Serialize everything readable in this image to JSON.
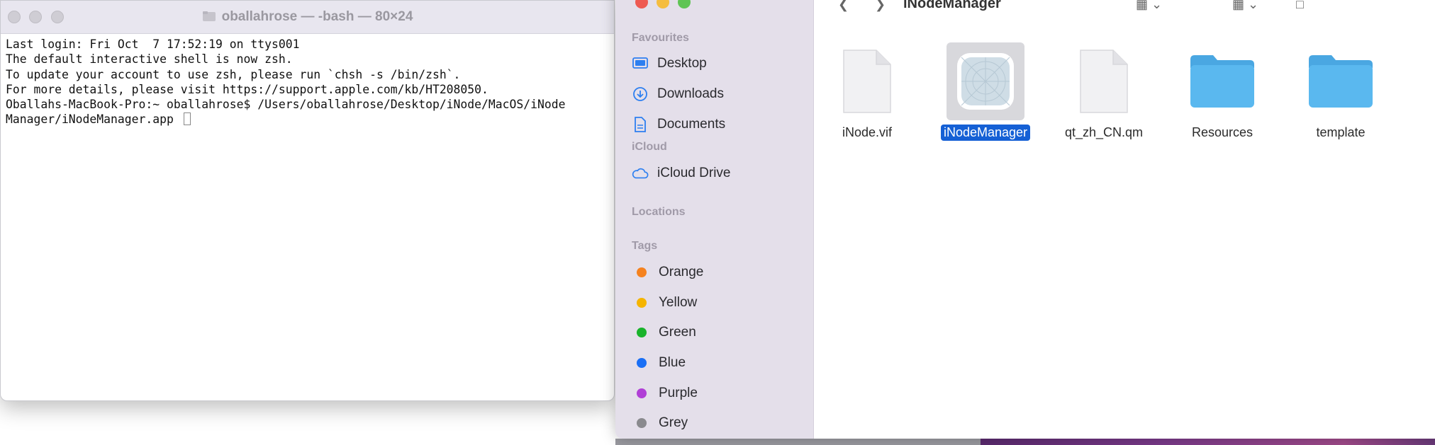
{
  "terminal": {
    "title": "oballahrose — -bash — 80×24",
    "lines": [
      "Last login: Fri Oct  7 17:52:19 on ttys001",
      "",
      "The default interactive shell is now zsh.",
      "To update your account to use zsh, please run `chsh -s /bin/zsh`.",
      "For more details, please visit https://support.apple.com/kb/HT208050.",
      "Oballahs-MacBook-Pro:~ oballahrose$ /Users/oballahrose/Desktop/iNode/MacOS/iNode",
      "Manager/iNodeManager.app "
    ]
  },
  "finder": {
    "title": "iNodeManager",
    "sidebar": {
      "favourites_heading": "Favourites",
      "favourites": [
        {
          "label": "Desktop",
          "icon": "desktop-icon"
        },
        {
          "label": "Downloads",
          "icon": "downloads-icon"
        },
        {
          "label": "Documents",
          "icon": "documents-icon"
        }
      ],
      "icloud_heading": "iCloud",
      "icloud": [
        {
          "label": "iCloud Drive",
          "icon": "icloud-icon"
        }
      ],
      "locations_heading": "Locations",
      "tags_heading": "Tags",
      "tags": [
        {
          "label": "Orange",
          "color": "#f5821f"
        },
        {
          "label": "Yellow",
          "color": "#f5b400"
        },
        {
          "label": "Green",
          "color": "#19b32b"
        },
        {
          "label": "Blue",
          "color": "#1a6ff5"
        },
        {
          "label": "Purple",
          "color": "#b03fd6"
        },
        {
          "label": "Grey",
          "color": "#8a8a8e"
        }
      ]
    },
    "files": [
      {
        "name": "iNode.vif",
        "kind": "document",
        "selected": false
      },
      {
        "name": "iNodeManager",
        "kind": "app",
        "selected": true
      },
      {
        "name": "qt_zh_CN.qm",
        "kind": "document",
        "selected": false
      },
      {
        "name": "Resources",
        "kind": "folder",
        "selected": false
      },
      {
        "name": "template",
        "kind": "folder",
        "selected": false
      }
    ]
  },
  "colors": {
    "accent": "#1560d5",
    "folder": "#5ab8ef"
  }
}
